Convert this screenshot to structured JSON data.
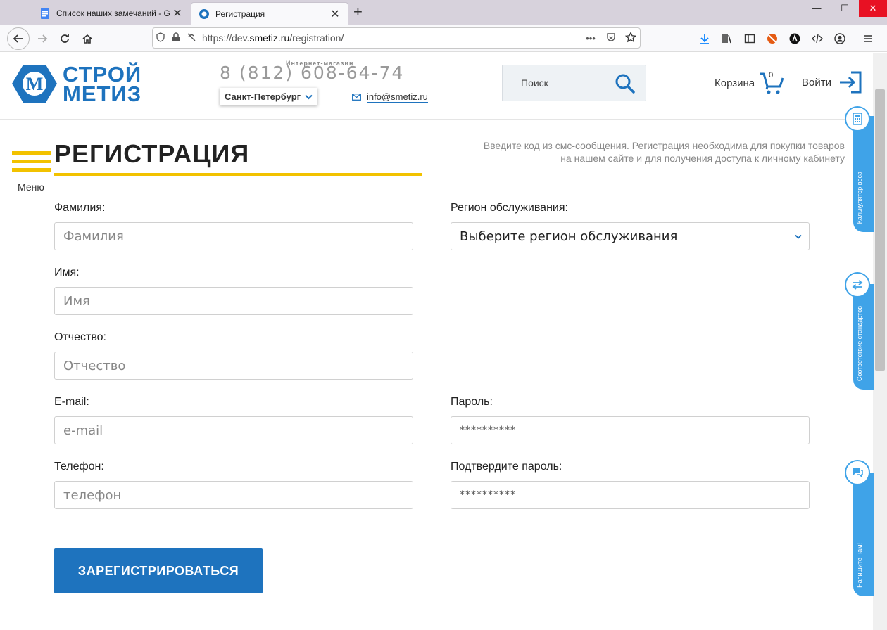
{
  "browser": {
    "tabs": [
      {
        "title": "Список наших замечаний - G",
        "active": false
      },
      {
        "title": "Регистрация",
        "active": true
      }
    ],
    "new_tab": "+",
    "close_tab": "✕",
    "window_controls": {
      "minimize": "—",
      "maximize": "☐",
      "close": "✕"
    },
    "url_prefix": "https://dev.",
    "url_domain": "smetiz.ru",
    "url_path": "/registration/",
    "url_menu": "•••"
  },
  "header": {
    "logo_line1": "СТРОЙ",
    "logo_line2": "МЕТИЗ",
    "shop_label": "Интернет-магазин",
    "phone": "8 (812) 608-64-74",
    "city": "Санкт-Петербург",
    "email": "info@smetiz.ru",
    "search_placeholder": "Поиск",
    "cart_label": "Корзина",
    "cart_count": "0",
    "login_label": "Войти"
  },
  "page": {
    "menu_label": "Меню",
    "title": "РЕГИСТРАЦИЯ",
    "hint": "Введите код из смс-сообщения. Регистрация необходима для покупки товаров на нашем сайте и для получения доступа к личному кабинету"
  },
  "form": {
    "last_name": {
      "label": "Фамилия:",
      "placeholder": "Фамилия"
    },
    "first_name": {
      "label": "Имя:",
      "placeholder": "Имя"
    },
    "patronymic": {
      "label": "Отчество:",
      "placeholder": "Отчество"
    },
    "email": {
      "label": "E-mail:",
      "placeholder": "e-mail"
    },
    "phone": {
      "label": "Телефон:",
      "placeholder": "телефон"
    },
    "region": {
      "label": "Регион обслуживания:",
      "value": "Выберите регион обслуживания"
    },
    "password": {
      "label": "Пароль:",
      "placeholder": "**********"
    },
    "password_confirm": {
      "label": "Подтвердите пароль:",
      "placeholder": "**********"
    },
    "submit_label": "ЗАРЕГИСТРИРОВАТЬСЯ"
  },
  "side_widgets": {
    "weight_calc": "Калькулятор веса",
    "standards": "Соответствие стандартов",
    "write_us": "Напишите нам!"
  },
  "colors": {
    "brand_blue": "#1e73be",
    "accent_yellow": "#f2c200",
    "widget_blue": "#3fa3e8"
  }
}
